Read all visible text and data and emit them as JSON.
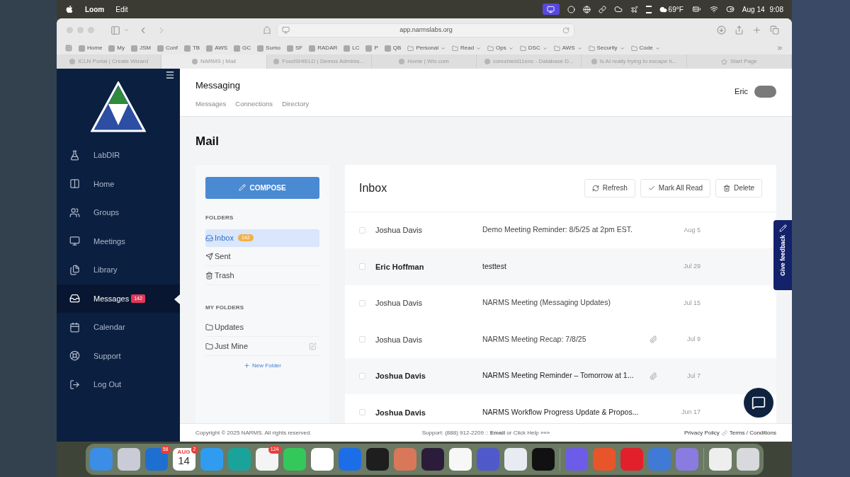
{
  "menubar": {
    "app": "Loom",
    "menus": [
      "Edit"
    ],
    "weather": "69°F",
    "date": "Aug 14",
    "time": "9:08"
  },
  "browser": {
    "address": "app.narmslabs.org",
    "bookmarks": [
      {
        "label": "Home",
        "kind": "link"
      },
      {
        "label": "My",
        "kind": "link"
      },
      {
        "label": "JSM",
        "kind": "link"
      },
      {
        "label": "Conf",
        "kind": "link"
      },
      {
        "label": "TB",
        "kind": "link"
      },
      {
        "label": "AWS",
        "kind": "link"
      },
      {
        "label": "GC",
        "kind": "link"
      },
      {
        "label": "Sumo",
        "kind": "link"
      },
      {
        "label": "SF",
        "kind": "link"
      },
      {
        "label": "RADAR",
        "kind": "link"
      },
      {
        "label": "LC",
        "kind": "link"
      },
      {
        "label": "P",
        "kind": "link"
      },
      {
        "label": "QB",
        "kind": "link"
      },
      {
        "label": "Personal",
        "kind": "folder"
      },
      {
        "label": "Read",
        "kind": "folder"
      },
      {
        "label": "Ops",
        "kind": "folder"
      },
      {
        "label": "DSC",
        "kind": "folder"
      },
      {
        "label": "AWS",
        "kind": "folder"
      },
      {
        "label": "Security",
        "kind": "folder"
      },
      {
        "label": "Code",
        "kind": "folder"
      }
    ],
    "tabs": [
      {
        "label": "ICLN Portal | Create Wizard",
        "selected": false
      },
      {
        "label": "NARMS | Mail",
        "selected": true
      },
      {
        "label": "FoodSHIELD | Demos Adminis...",
        "selected": false
      },
      {
        "label": "Home | Wix.com",
        "selected": false
      },
      {
        "label": "coreshield11enc - Database D...",
        "selected": false
      },
      {
        "label": "Is AI really trying to escape h...",
        "selected": false
      },
      {
        "label": "Start Page",
        "selected": false
      }
    ]
  },
  "sidebar": {
    "items": [
      {
        "label": "LabDIR",
        "selected": false
      },
      {
        "label": "Home",
        "selected": false
      },
      {
        "label": "Groups",
        "selected": false
      },
      {
        "label": "Meetings",
        "selected": false
      },
      {
        "label": "Library",
        "selected": false
      },
      {
        "label": "Messages",
        "badge": "142",
        "selected": true
      },
      {
        "label": "Calendar",
        "selected": false
      },
      {
        "label": "Support",
        "selected": false
      },
      {
        "label": "Log Out",
        "selected": false
      }
    ]
  },
  "header": {
    "title": "Messaging",
    "nav": [
      "Messages",
      "Connections",
      "Directory"
    ],
    "user": "Eric"
  },
  "mail": {
    "title": "Mail",
    "compose": "COMPOSE",
    "folders_heading": "FOLDERS",
    "folders": [
      {
        "label": "Inbox",
        "badge": "142",
        "selected": true
      },
      {
        "label": "Sent",
        "selected": false
      },
      {
        "label": "Trash",
        "selected": false
      }
    ],
    "my_folders_heading": "MY FOLDERS",
    "my_folders": [
      {
        "label": "Updates",
        "editable": false
      },
      {
        "label": "Just Mine",
        "editable": true
      }
    ],
    "new_folder": "New Folder"
  },
  "inbox": {
    "title": "Inbox",
    "actions": [
      "Refresh",
      "Mark All Read",
      "Delete"
    ],
    "rows": [
      {
        "sender": "Joshua Davis",
        "subject": "Demo Meeting Reminder: 8/5/25 at 2pm EST.",
        "date": "Aug 5",
        "attachment": false,
        "unread": false,
        "checked": false
      },
      {
        "sender": "Eric Hoffman",
        "subject": "testtest",
        "date": "Jul 29",
        "attachment": false,
        "unread": true,
        "checked": false
      },
      {
        "sender": "Joshua Davis",
        "subject": "NARMS Meeting (Messaging Updates)",
        "date": "Jul 15",
        "attachment": false,
        "unread": false,
        "checked": false
      },
      {
        "sender": "Joshua Davis",
        "subject": "NARMS Meeting Recap: 7/8/25",
        "date": "Jul 9",
        "attachment": true,
        "unread": false,
        "checked": false
      },
      {
        "sender": "Joshua Davis",
        "subject": "NARMS Meeting Reminder – Tomorrow at 1...",
        "date": "Jul 7",
        "attachment": true,
        "unread": true,
        "checked": false
      },
      {
        "sender": "Joshua Davis",
        "subject": "NARMS Workflow Progress Update & Propos...",
        "date": "Jun 17",
        "attachment": false,
        "unread": true,
        "checked": false
      }
    ]
  },
  "footer": {
    "copyright": "Copyright © 2025 NARMS. All rights reserved.",
    "support": "Support: (888) 912-2209 :: **Email** or Click Help »»»",
    "links": [
      "Privacy Policy",
      "Terms / Conditions"
    ]
  },
  "feedback": "Give feedback",
  "dock": [
    {
      "kind": "app",
      "color": "#3b8de6"
    },
    {
      "kind": "app",
      "color": "#c9ccd6"
    },
    {
      "kind": "app",
      "color": "#1f6fd1",
      "badge": "58"
    },
    {
      "kind": "calendar",
      "color": "#ffffff",
      "month": "AUG",
      "day": "14",
      "badge": "2"
    },
    {
      "kind": "app",
      "color": "#2f9cf0"
    },
    {
      "kind": "app",
      "color": "#1aa39a"
    },
    {
      "kind": "app",
      "color": "#f4f4f4",
      "badge": "124"
    },
    {
      "kind": "app",
      "color": "#34c759"
    },
    {
      "kind": "app",
      "color": "#ffffff"
    },
    {
      "kind": "app",
      "color": "#1c6ee8"
    },
    {
      "kind": "app",
      "color": "#1e1e1e"
    },
    {
      "kind": "app",
      "color": "#d9775a"
    },
    {
      "kind": "app",
      "color": "#2b1d3a"
    },
    {
      "kind": "app",
      "color": "#f7f7f7"
    },
    {
      "kind": "app",
      "color": "#5059c9"
    },
    {
      "kind": "app",
      "color": "#e8ecf2"
    },
    {
      "kind": "app",
      "color": "#111111"
    },
    {
      "kind": "separator"
    },
    {
      "kind": "app",
      "color": "#6d5ce7"
    },
    {
      "kind": "app",
      "color": "#e8552a"
    },
    {
      "kind": "app",
      "color": "#e2202b"
    },
    {
      "kind": "app",
      "color": "#3f7bd6"
    },
    {
      "kind": "app",
      "color": "#8a7be0"
    },
    {
      "kind": "separator"
    },
    {
      "kind": "app",
      "color": "#eeeeee"
    },
    {
      "kind": "app",
      "color": "#d7d9dc"
    }
  ]
}
